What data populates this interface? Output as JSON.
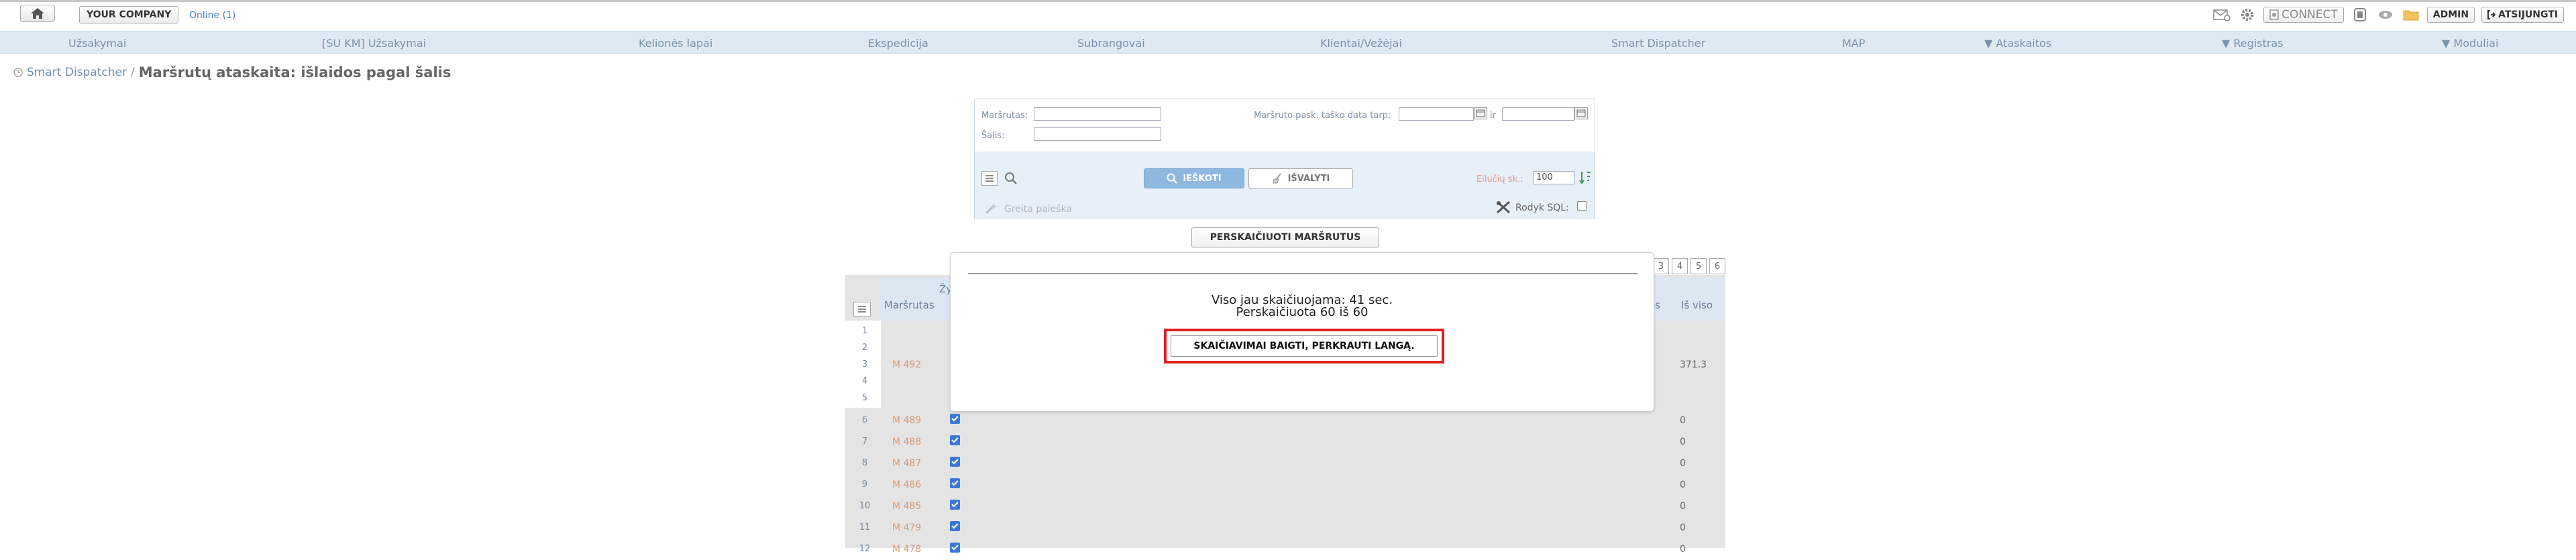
{
  "topbar": {
    "company": "YOUR COMPANY",
    "online": "Online (1)",
    "connect": "CONNECT",
    "admin": "ADMIN",
    "logout": "ATSIJUNGTI"
  },
  "nav": [
    {
      "label": "Užsakymai"
    },
    {
      "label": "[SU KM] Užsakymai"
    },
    {
      "label": "Kelionės lapai"
    },
    {
      "label": "Ekspedicija"
    },
    {
      "label": "Subrangovai"
    },
    {
      "label": "Klientai/Vežėjai"
    },
    {
      "label": "Smart Dispatcher"
    },
    {
      "label": "MAP"
    },
    {
      "label": "▼ Ataskaitos"
    },
    {
      "label": "▼ Registras"
    },
    {
      "label": "▼ Moduliai"
    }
  ],
  "breadcrumb": {
    "link": "Smart Dispatcher",
    "sep": "/",
    "title": "Maršrutų ataskaita: išlaidos pagal šalis"
  },
  "filter": {
    "route_label": "Maršrutas:",
    "country_label": "Šalis:",
    "date_label": "Maršruto pask. taško data tarp:",
    "and_label": "ir",
    "search_btn": "IEŠKOTI",
    "clear_btn": "IŠVALYTI",
    "rows_label": "Eilučių sk.:",
    "rows_value": "100",
    "quick_search": "Greita paieška",
    "show_sql": "Rodyk SQL:"
  },
  "recalc_btn": "PERSKAIČIUOTI MARŠRUTUS",
  "table": {
    "col_route": "Maršrutas",
    "col_partial": "Žy",
    "col_os": "os",
    "col_total": "Iš viso",
    "pager": [
      "3",
      "4",
      "5",
      "6"
    ],
    "rows": [
      {
        "n": "1",
        "route": "",
        "checked": false,
        "total": ""
      },
      {
        "n": "2",
        "route": "",
        "checked": false,
        "total": ""
      },
      {
        "n": "3",
        "route": "M 492",
        "checked": false,
        "total": "371.3"
      },
      {
        "n": "4",
        "route": "",
        "checked": false,
        "total": ""
      },
      {
        "n": "5",
        "route": "",
        "checked": false,
        "total": ""
      },
      {
        "n": "6",
        "route": "M 489",
        "checked": true,
        "total": "0"
      },
      {
        "n": "7",
        "route": "M 488",
        "checked": true,
        "total": "0"
      },
      {
        "n": "8",
        "route": "M 487",
        "checked": true,
        "total": "0"
      },
      {
        "n": "9",
        "route": "M 486",
        "checked": true,
        "total": "0"
      },
      {
        "n": "10",
        "route": "M 485",
        "checked": true,
        "total": "0"
      },
      {
        "n": "11",
        "route": "M 479",
        "checked": true,
        "total": "0"
      },
      {
        "n": "12",
        "route": "M 478",
        "checked": true,
        "total": "0"
      }
    ]
  },
  "modal": {
    "line1": "Viso jau skaičiuojama: 41 sec.",
    "line2": "Perskaičiuota 60 iš 60",
    "button": "SKAIČIAVIMAI BAIGTI, PERKRAUTI LANGĄ."
  }
}
